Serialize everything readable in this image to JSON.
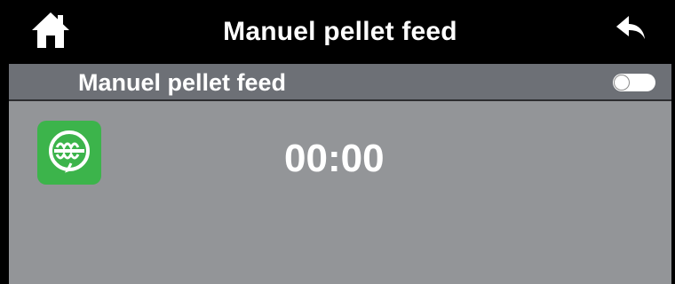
{
  "header": {
    "title": "Manuel pellet feed",
    "home_icon": "home-icon",
    "back_icon": "back-arrow-icon"
  },
  "subheader": {
    "label": "Manuel pellet feed",
    "toggle_on": false
  },
  "main": {
    "feed_icon": "auger-feed-icon",
    "timer": "00:00"
  },
  "colors": {
    "topbar": "#000000",
    "subbar": "#6d7076",
    "content": "#939598",
    "icon_bg": "#3cb44b",
    "text": "#ffffff"
  }
}
